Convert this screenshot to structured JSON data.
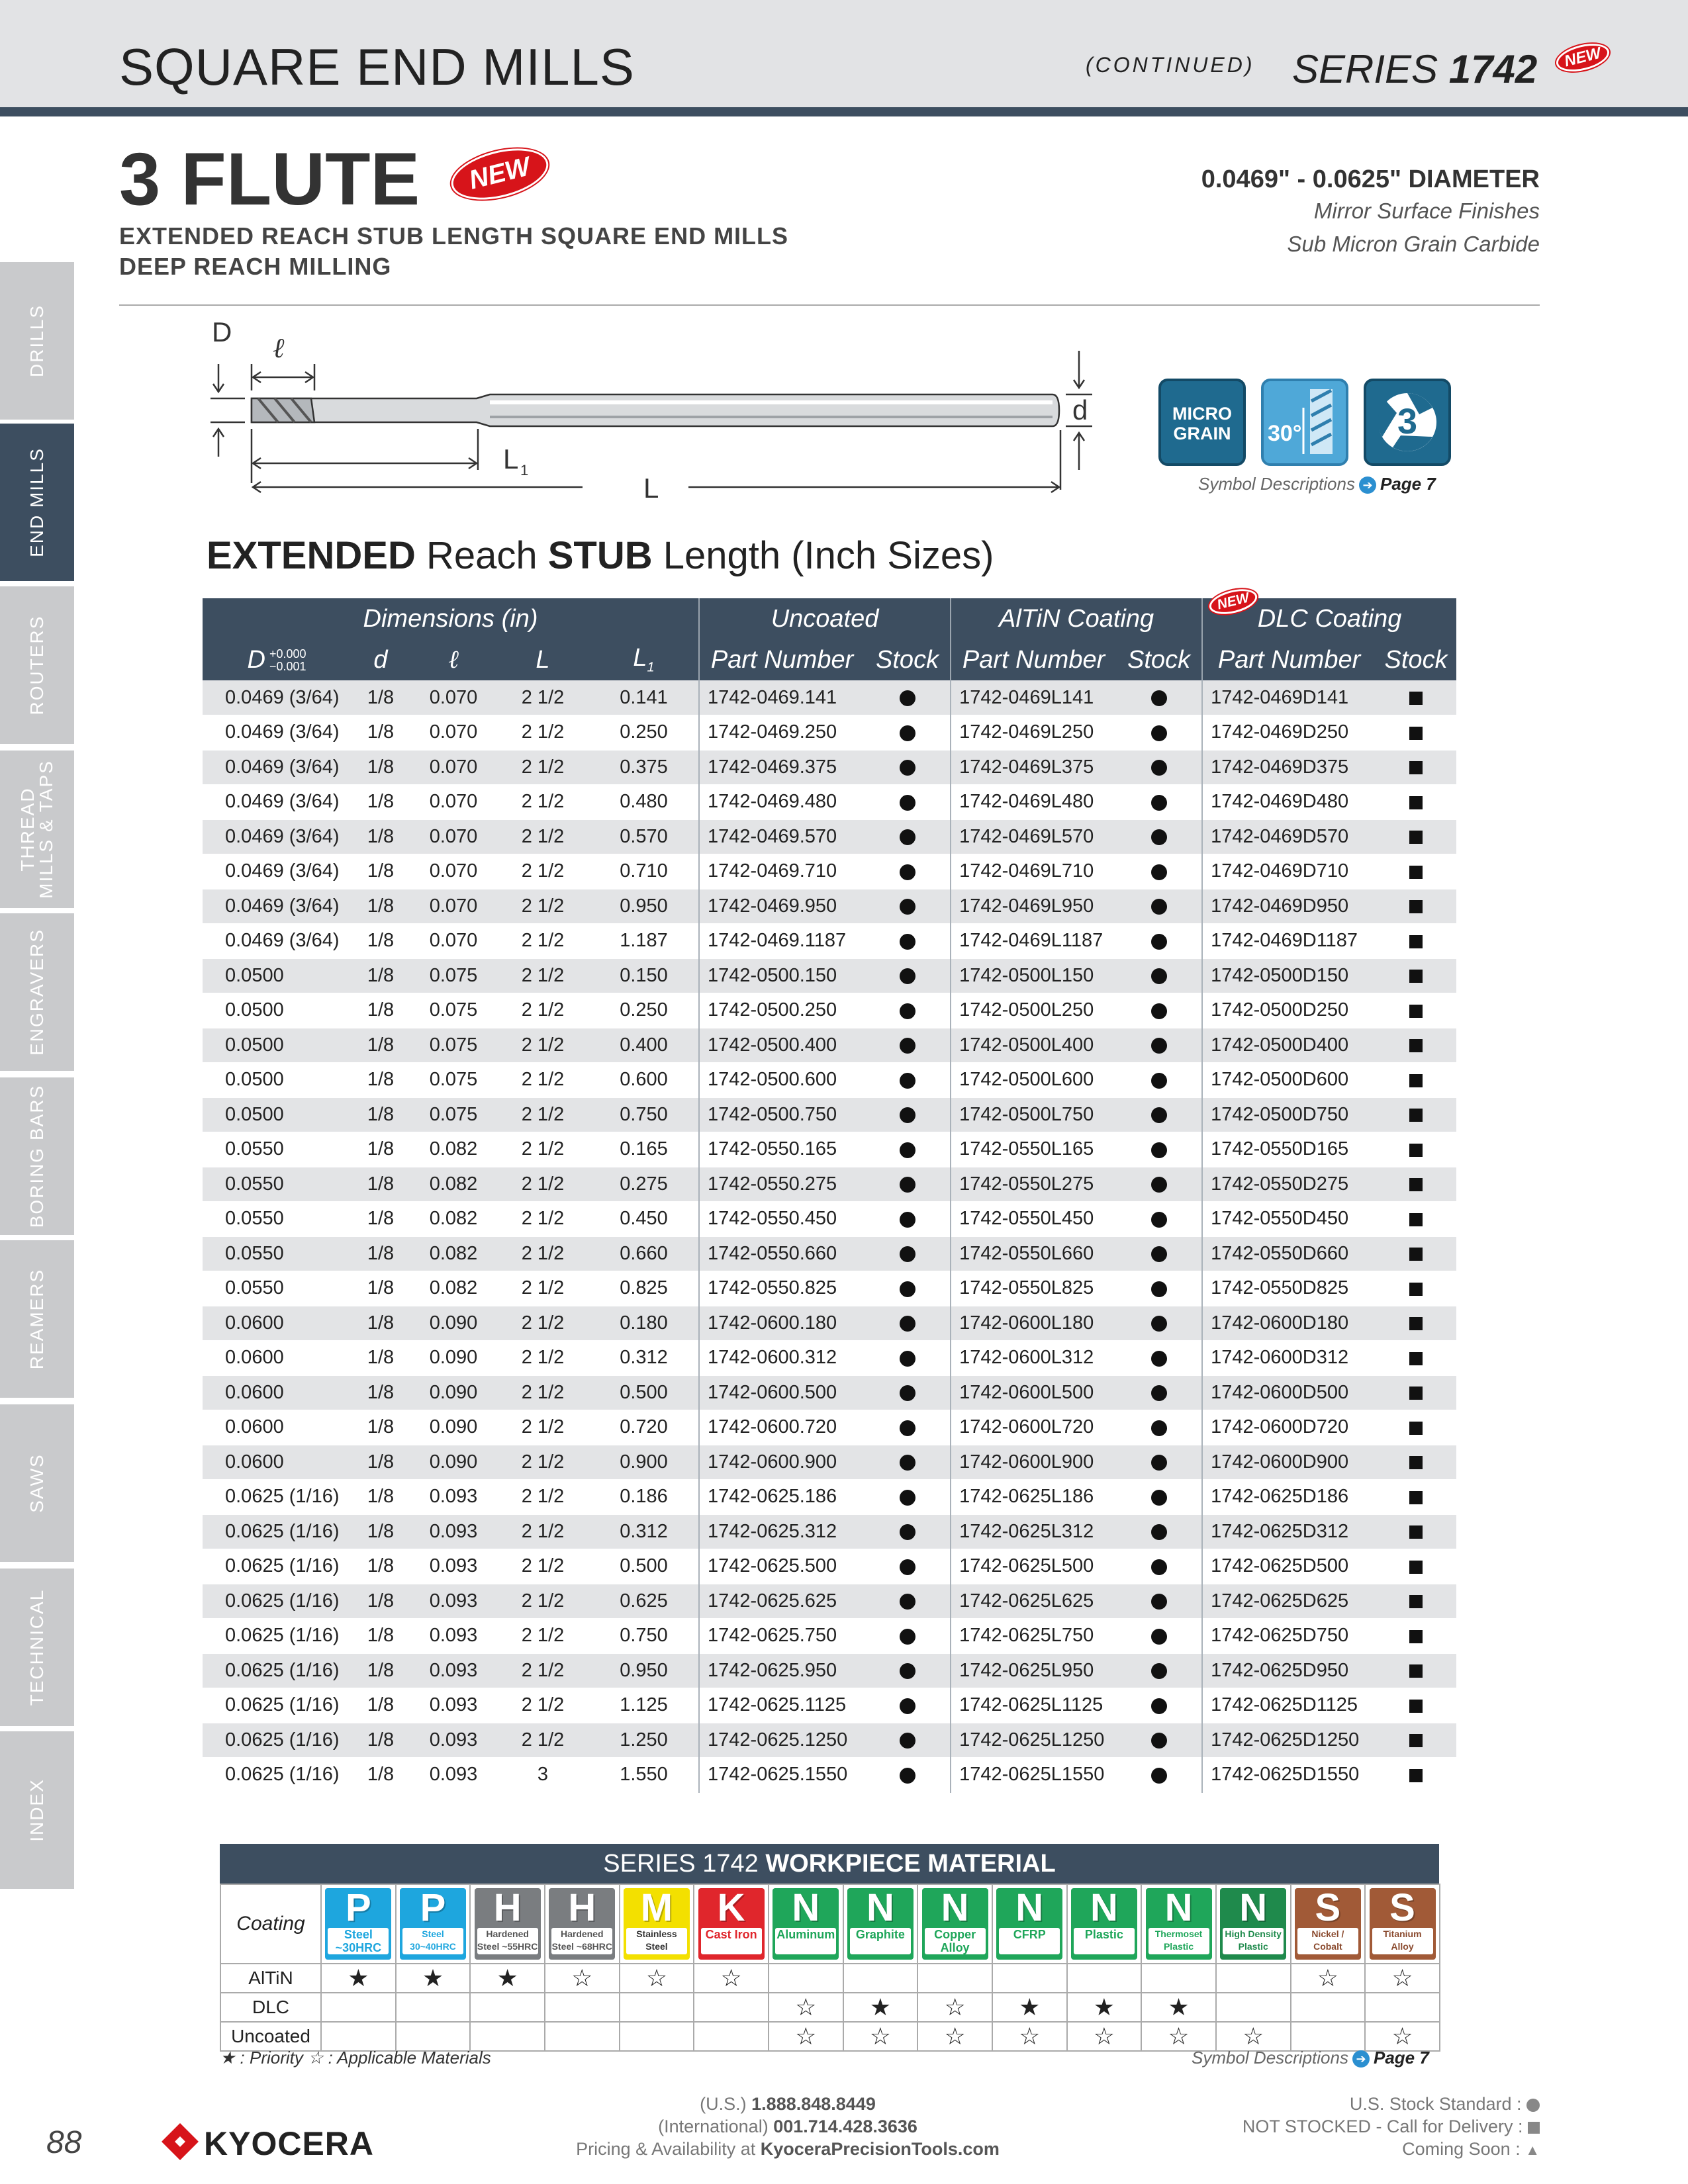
{
  "header": {
    "title": "SQUARE END MILLS",
    "continued": "(CONTINUED)",
    "series_prefix": "SERIES ",
    "series_number": "1742",
    "new_badge": "NEW"
  },
  "sidebar": {
    "tabs": [
      {
        "label": "DRILLS",
        "active": false
      },
      {
        "label": "END MILLS",
        "active": true
      },
      {
        "label": "ROUTERS",
        "active": false
      },
      {
        "label": "THREAD MILLS & TAPS",
        "active": false
      },
      {
        "label": "ENGRAVERS",
        "active": false
      },
      {
        "label": "BORING BARS",
        "active": false
      },
      {
        "label": "REAMERS",
        "active": false
      },
      {
        "label": "SAWS",
        "active": false
      },
      {
        "label": "TECHNICAL",
        "active": false
      },
      {
        "label": "INDEX",
        "active": false
      }
    ]
  },
  "product": {
    "flute": "3 FLUTE",
    "new_badge": "NEW",
    "subtitle1": "EXTENDED REACH STUB LENGTH SQUARE END MILLS",
    "subtitle2": "DEEP REACH MILLING",
    "diameter_range": "0.0469\" - 0.0625\" DIAMETER",
    "finish1": "Mirror Surface Finishes",
    "finish2": "Sub Micron Grain Carbide"
  },
  "diagram": {
    "label_D": "D",
    "label_l": "ℓ",
    "label_d": "d",
    "label_L1": "L",
    "label_L1_sub": "1",
    "label_L": "L"
  },
  "symbols": {
    "micro_grain_line1": "MICRO",
    "micro_grain_line2": "GRAIN",
    "angle": "30°",
    "flutes": "3",
    "desc": "Symbol Descriptions",
    "page": "Page 7"
  },
  "table": {
    "title_bold1": "EXTENDED",
    "title_reg1": " Reach ",
    "title_bold2": "STUB",
    "title_reg2": " Length (Inch Sizes)",
    "groups": {
      "dimensions": "Dimensions (in)",
      "uncoated": "Uncoated",
      "altin": "AlTiN Coating",
      "dlc": "DLC Coating",
      "dlc_new": "NEW"
    },
    "cols": {
      "D": "D",
      "D_tol_plus": "+0.000",
      "D_tol_minus": "−0.001",
      "d": "d",
      "l": "ℓ",
      "L": "L",
      "L1": "L",
      "L1_sub": "1",
      "part_number": "Part Number",
      "stock": "Stock"
    },
    "rows": [
      {
        "D": "0.0469 (3/64)",
        "d": "1/8",
        "l": "0.070",
        "L": "2 1/2",
        "L1": "0.141",
        "un": "1742-0469.141",
        "al": "1742-0469L141",
        "dlc": "1742-0469D141"
      },
      {
        "D": "0.0469 (3/64)",
        "d": "1/8",
        "l": "0.070",
        "L": "2 1/2",
        "L1": "0.250",
        "un": "1742-0469.250",
        "al": "1742-0469L250",
        "dlc": "1742-0469D250"
      },
      {
        "D": "0.0469 (3/64)",
        "d": "1/8",
        "l": "0.070",
        "L": "2 1/2",
        "L1": "0.375",
        "un": "1742-0469.375",
        "al": "1742-0469L375",
        "dlc": "1742-0469D375"
      },
      {
        "D": "0.0469 (3/64)",
        "d": "1/8",
        "l": "0.070",
        "L": "2 1/2",
        "L1": "0.480",
        "un": "1742-0469.480",
        "al": "1742-0469L480",
        "dlc": "1742-0469D480"
      },
      {
        "D": "0.0469 (3/64)",
        "d": "1/8",
        "l": "0.070",
        "L": "2 1/2",
        "L1": "0.570",
        "un": "1742-0469.570",
        "al": "1742-0469L570",
        "dlc": "1742-0469D570"
      },
      {
        "D": "0.0469 (3/64)",
        "d": "1/8",
        "l": "0.070",
        "L": "2 1/2",
        "L1": "0.710",
        "un": "1742-0469.710",
        "al": "1742-0469L710",
        "dlc": "1742-0469D710"
      },
      {
        "D": "0.0469 (3/64)",
        "d": "1/8",
        "l": "0.070",
        "L": "2 1/2",
        "L1": "0.950",
        "un": "1742-0469.950",
        "al": "1742-0469L950",
        "dlc": "1742-0469D950"
      },
      {
        "D": "0.0469 (3/64)",
        "d": "1/8",
        "l": "0.070",
        "L": "2 1/2",
        "L1": "1.187",
        "un": "1742-0469.1187",
        "al": "1742-0469L1187",
        "dlc": "1742-0469D1187"
      },
      {
        "D": "0.0500",
        "d": "1/8",
        "l": "0.075",
        "L": "2 1/2",
        "L1": "0.150",
        "un": "1742-0500.150",
        "al": "1742-0500L150",
        "dlc": "1742-0500D150"
      },
      {
        "D": "0.0500",
        "d": "1/8",
        "l": "0.075",
        "L": "2 1/2",
        "L1": "0.250",
        "un": "1742-0500.250",
        "al": "1742-0500L250",
        "dlc": "1742-0500D250"
      },
      {
        "D": "0.0500",
        "d": "1/8",
        "l": "0.075",
        "L": "2 1/2",
        "L1": "0.400",
        "un": "1742-0500.400",
        "al": "1742-0500L400",
        "dlc": "1742-0500D400"
      },
      {
        "D": "0.0500",
        "d": "1/8",
        "l": "0.075",
        "L": "2 1/2",
        "L1": "0.600",
        "un": "1742-0500.600",
        "al": "1742-0500L600",
        "dlc": "1742-0500D600"
      },
      {
        "D": "0.0500",
        "d": "1/8",
        "l": "0.075",
        "L": "2 1/2",
        "L1": "0.750",
        "un": "1742-0500.750",
        "al": "1742-0500L750",
        "dlc": "1742-0500D750"
      },
      {
        "D": "0.0550",
        "d": "1/8",
        "l": "0.082",
        "L": "2 1/2",
        "L1": "0.165",
        "un": "1742-0550.165",
        "al": "1742-0550L165",
        "dlc": "1742-0550D165"
      },
      {
        "D": "0.0550",
        "d": "1/8",
        "l": "0.082",
        "L": "2 1/2",
        "L1": "0.275",
        "un": "1742-0550.275",
        "al": "1742-0550L275",
        "dlc": "1742-0550D275"
      },
      {
        "D": "0.0550",
        "d": "1/8",
        "l": "0.082",
        "L": "2 1/2",
        "L1": "0.450",
        "un": "1742-0550.450",
        "al": "1742-0550L450",
        "dlc": "1742-0550D450"
      },
      {
        "D": "0.0550",
        "d": "1/8",
        "l": "0.082",
        "L": "2 1/2",
        "L1": "0.660",
        "un": "1742-0550.660",
        "al": "1742-0550L660",
        "dlc": "1742-0550D660"
      },
      {
        "D": "0.0550",
        "d": "1/8",
        "l": "0.082",
        "L": "2 1/2",
        "L1": "0.825",
        "un": "1742-0550.825",
        "al": "1742-0550L825",
        "dlc": "1742-0550D825"
      },
      {
        "D": "0.0600",
        "d": "1/8",
        "l": "0.090",
        "L": "2 1/2",
        "L1": "0.180",
        "un": "1742-0600.180",
        "al": "1742-0600L180",
        "dlc": "1742-0600D180"
      },
      {
        "D": "0.0600",
        "d": "1/8",
        "l": "0.090",
        "L": "2 1/2",
        "L1": "0.312",
        "un": "1742-0600.312",
        "al": "1742-0600L312",
        "dlc": "1742-0600D312"
      },
      {
        "D": "0.0600",
        "d": "1/8",
        "l": "0.090",
        "L": "2 1/2",
        "L1": "0.500",
        "un": "1742-0600.500",
        "al": "1742-0600L500",
        "dlc": "1742-0600D500"
      },
      {
        "D": "0.0600",
        "d": "1/8",
        "l": "0.090",
        "L": "2 1/2",
        "L1": "0.720",
        "un": "1742-0600.720",
        "al": "1742-0600L720",
        "dlc": "1742-0600D720"
      },
      {
        "D": "0.0600",
        "d": "1/8",
        "l": "0.090",
        "L": "2 1/2",
        "L1": "0.900",
        "un": "1742-0600.900",
        "al": "1742-0600L900",
        "dlc": "1742-0600D900"
      },
      {
        "D": "0.0625 (1/16)",
        "d": "1/8",
        "l": "0.093",
        "L": "2 1/2",
        "L1": "0.186",
        "un": "1742-0625.186",
        "al": "1742-0625L186",
        "dlc": "1742-0625D186"
      },
      {
        "D": "0.0625 (1/16)",
        "d": "1/8",
        "l": "0.093",
        "L": "2 1/2",
        "L1": "0.312",
        "un": "1742-0625.312",
        "al": "1742-0625L312",
        "dlc": "1742-0625D312"
      },
      {
        "D": "0.0625 (1/16)",
        "d": "1/8",
        "l": "0.093",
        "L": "2 1/2",
        "L1": "0.500",
        "un": "1742-0625.500",
        "al": "1742-0625L500",
        "dlc": "1742-0625D500"
      },
      {
        "D": "0.0625 (1/16)",
        "d": "1/8",
        "l": "0.093",
        "L": "2 1/2",
        "L1": "0.625",
        "un": "1742-0625.625",
        "al": "1742-0625L625",
        "dlc": "1742-0625D625"
      },
      {
        "D": "0.0625 (1/16)",
        "d": "1/8",
        "l": "0.093",
        "L": "2 1/2",
        "L1": "0.750",
        "un": "1742-0625.750",
        "al": "1742-0625L750",
        "dlc": "1742-0625D750"
      },
      {
        "D": "0.0625 (1/16)",
        "d": "1/8",
        "l": "0.093",
        "L": "2 1/2",
        "L1": "0.950",
        "un": "1742-0625.950",
        "al": "1742-0625L950",
        "dlc": "1742-0625D950"
      },
      {
        "D": "0.0625 (1/16)",
        "d": "1/8",
        "l": "0.093",
        "L": "2 1/2",
        "L1": "1.125",
        "un": "1742-0625.1125",
        "al": "1742-0625L1125",
        "dlc": "1742-0625D1125"
      },
      {
        "D": "0.0625 (1/16)",
        "d": "1/8",
        "l": "0.093",
        "L": "2 1/2",
        "L1": "1.250",
        "un": "1742-0625.1250",
        "al": "1742-0625L1250",
        "dlc": "1742-0625D1250"
      },
      {
        "D": "0.0625 (1/16)",
        "d": "1/8",
        "l": "0.093",
        "L": "3",
        "L1": "1.550",
        "un": "1742-0625.1550",
        "al": "1742-0625L1550",
        "dlc": "1742-0625D1550"
      }
    ]
  },
  "workpiece": {
    "title_prefix": "SERIES 1742 ",
    "title_bold": "WORKPIECE MATERIAL",
    "coating_label": "Coating",
    "materials": [
      {
        "letter": "P",
        "label": "Steel ~30HRC",
        "color": "#1ea6de",
        "text_color": "#1ea6de"
      },
      {
        "letter": "P",
        "label": "Steel 30~40HRC",
        "color": "#1ea6de",
        "text_color": "#1ea6de"
      },
      {
        "letter": "H",
        "label": "Hardened Steel ~55HRC",
        "color": "#7a7d80",
        "text_color": "#555555"
      },
      {
        "letter": "H",
        "label": "Hardened Steel ~68HRC",
        "color": "#7a7d80",
        "text_color": "#555555"
      },
      {
        "letter": "M",
        "label": "Stainless Steel",
        "color": "#f3e000",
        "text_color": "#333333"
      },
      {
        "letter": "K",
        "label": "Cast Iron",
        "color": "#e0262c",
        "text_color": "#e0262c"
      },
      {
        "letter": "N",
        "label": "Aluminum",
        "color": "#1fa65a",
        "text_color": "#1fa65a"
      },
      {
        "letter": "N",
        "label": "Graphite",
        "color": "#1fa65a",
        "text_color": "#1fa65a"
      },
      {
        "letter": "N",
        "label": "Copper Alloy",
        "color": "#1fa65a",
        "text_color": "#1fa65a"
      },
      {
        "letter": "N",
        "label": "CFRP",
        "color": "#1fa65a",
        "text_color": "#1fa65a"
      },
      {
        "letter": "N",
        "label": "Plastic",
        "color": "#1fa65a",
        "text_color": "#1fa65a"
      },
      {
        "letter": "N",
        "label": "Thermoset Plastic",
        "color": "#1fa65a",
        "text_color": "#1fa65a"
      },
      {
        "letter": "N",
        "label": "High Density Plastic",
        "color": "#1f8a4c",
        "text_color": "#1f8a4c"
      },
      {
        "letter": "S",
        "label": "Nickel / Cobalt",
        "color": "#a15a37",
        "text_color": "#8a4a2e"
      },
      {
        "letter": "S",
        "label": "Titanium Alloy",
        "color": "#a15a37",
        "text_color": "#8a4a2e"
      }
    ],
    "rows": [
      {
        "coating": "AlTiN",
        "marks": [
          "★",
          "★",
          "★",
          "☆",
          "☆",
          "☆",
          "",
          "",
          "",
          "",
          "",
          "",
          "",
          "☆",
          "☆"
        ]
      },
      {
        "coating": "DLC",
        "marks": [
          "",
          "",
          "",
          "",
          "",
          "",
          "☆",
          "★",
          "☆",
          "★",
          "★",
          "★",
          "",
          "",
          ""
        ]
      },
      {
        "coating": "Uncoated",
        "marks": [
          "",
          "",
          "",
          "",
          "",
          "",
          "☆",
          "☆",
          "☆",
          "☆",
          "☆",
          "☆",
          "☆",
          "",
          "☆"
        ]
      }
    ],
    "legend": "★ : Priority  ☆ : Applicable Materials",
    "symdesc": "Symbol Descriptions",
    "page": "Page 7"
  },
  "footer": {
    "page_number": "88",
    "logo": "KYOCERA",
    "us_label": "(U.S.) ",
    "us_phone": "1.888.848.8449",
    "intl_label": "(International) ",
    "intl_phone": "001.714.428.3636",
    "pricing_label": "Pricing & Availability at ",
    "website": "KyoceraPrecisionTools.com",
    "stock_standard": "U.S. Stock Standard :",
    "not_stocked": "NOT STOCKED - Call for Delivery :",
    "coming_soon": "Coming Soon :"
  }
}
